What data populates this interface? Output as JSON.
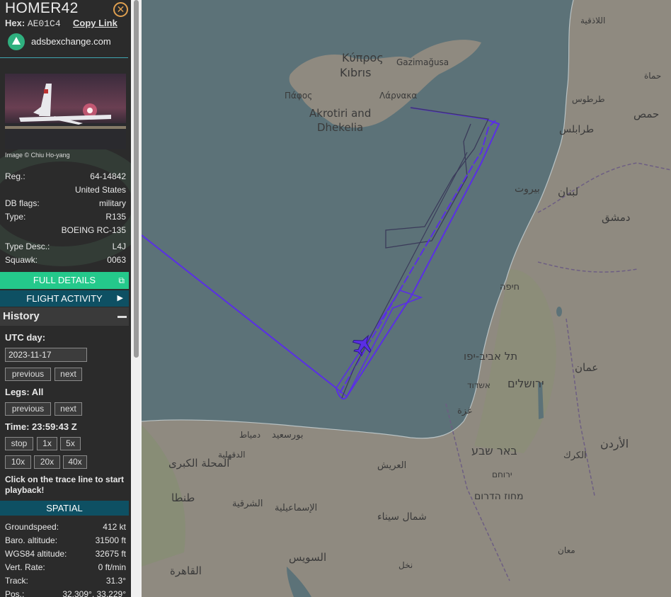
{
  "aircraft": {
    "callsign": "HOMER42",
    "hex_label": "Hex:",
    "hex": "AE01C4",
    "copy_link": "Copy Link",
    "source": "adsbexchange.com",
    "image_credit": "Image © Chiu Ho-yang"
  },
  "info": {
    "reg_label": "Reg.:",
    "reg": "64-14842",
    "country": "United States",
    "dbflags_label": "DB flags:",
    "dbflags": "military",
    "type_label": "Type:",
    "type": "R135",
    "model": "BOEING RC-135",
    "typedesc_label": "Type Desc.:",
    "typedesc": "L4J",
    "squawk_label": "Squawk:",
    "squawk": "0063"
  },
  "buttons": {
    "full_details": "FULL DETAILS",
    "flight_activity": "FLIGHT ACTIVITY"
  },
  "history": {
    "title": "History",
    "utc_day_label": "UTC day:",
    "utc_day": "2023-11-17",
    "previous": "previous",
    "next": "next",
    "legs_label": "Legs: All",
    "time_label": "Time: 23:59:43 Z",
    "stop": "stop",
    "speeds_row1": [
      "1x",
      "5x"
    ],
    "speeds_row2": [
      "10x",
      "20x",
      "40x"
    ],
    "hint": "Click on the trace line to start playback!"
  },
  "spatial": {
    "title": "SPATIAL",
    "groundspeed_label": "Groundspeed:",
    "groundspeed": "412 kt",
    "baro_label": "Baro. altitude:",
    "baro": "31500 ft",
    "wgs_label": "WGS84 altitude:",
    "wgs": "32675 ft",
    "vrate_label": "Vert. Rate:",
    "vrate": "0 ft/min",
    "track_label": "Track:",
    "track": "31.3°",
    "pos_label": "Pos.:",
    "pos": "32.309°, 33.229°"
  },
  "map_labels": {
    "cyprus_gr": "Κύπρος",
    "cyprus_tr": "Kıbrıs",
    "gazimagusa": "Gazimağusa",
    "pafos": "Πάφος",
    "larnaka": "Λάρνακα",
    "akrotiri": "Akrotiri and",
    "dhekelia": "Dhekelia",
    "beirut": "بيروت",
    "lebanon": "لبنان",
    "damascus": "دمشق",
    "homs": "حمص",
    "tripoli": "طرابلس",
    "haifa": "חיפה",
    "telaviv": "תל אביב-יפו",
    "jerusalem": "ירושלים",
    "amman": "عمان",
    "ashdod": "אשדוד",
    "gaza": "غزة",
    "beersheba": "באר שבע",
    "jordan": "الأردن",
    "portsaid": "بورسعيد",
    "damietta": "دمياط",
    "arish": "العريش",
    "ismailia": "الإسماعيلية",
    "north_sinai": "شمال سيناء",
    "suez": "السويس",
    "cairo": "القاهرة",
    "tanta": "طنطا",
    "mahalla": "المحلة الكبرى",
    "south_district": "מחוז הדרום",
    "nakhl": "نخل",
    "karak": "الكرك",
    "maan": "معان",
    "latakia": "اللاذقية",
    "hama": "حماة",
    "tartus": "طرطوس",
    "yeruham": "ירוחם",
    "sharqia": "الشرقية",
    "mansoura": "الدقهلية"
  },
  "colors": {
    "sidebar_bg": "#2b2b2b",
    "accent_green": "#24c98b",
    "accent_teal": "#0e5063",
    "trace": "#5a2ee6",
    "sea": "#5c7278",
    "land": "#8f8a80"
  }
}
